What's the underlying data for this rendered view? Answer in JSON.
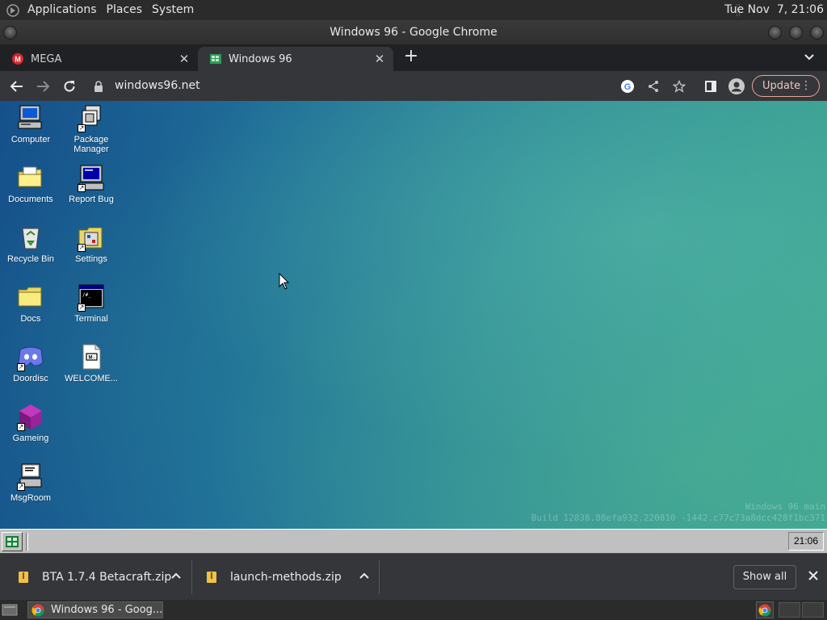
{
  "top_panel": {
    "menus": [
      "Applications",
      "Places",
      "System"
    ],
    "clock": "Tue Nov  7, 21:06"
  },
  "window": {
    "title": "Windows 96 - Google Chrome"
  },
  "tabs": [
    {
      "label": "MEGA",
      "active": false,
      "favicon": "mega-icon",
      "color": "#d9272e"
    },
    {
      "label": "Windows 96",
      "active": true,
      "favicon": "windows96-icon",
      "color": "#2e9c5a"
    }
  ],
  "toolbar": {
    "url": "windows96.net",
    "update_label": "Update"
  },
  "desktop": {
    "icons": [
      {
        "label": "Computer",
        "icon": "computer-icon"
      },
      {
        "label": "Package Manager",
        "icon": "package-manager-icon"
      },
      {
        "label": "Documents",
        "icon": "documents-folder-icon"
      },
      {
        "label": "Report Bug",
        "icon": "report-bug-icon"
      },
      {
        "label": "Recycle Bin",
        "icon": "recycle-bin-icon"
      },
      {
        "label": "Settings",
        "icon": "settings-icon"
      },
      {
        "label": "Docs",
        "icon": "docs-folder-icon"
      },
      {
        "label": "Terminal",
        "icon": "terminal-icon"
      },
      {
        "label": "Doordisc",
        "icon": "doordisc-icon"
      },
      {
        "label": "WELCOME...",
        "icon": "markdown-file-icon"
      },
      {
        "label": "Gameing",
        "icon": "gameing-icon"
      },
      {
        "label": "MsgRoom",
        "icon": "msgroom-icon"
      }
    ],
    "watermark_line1": "Windows 96 main",
    "watermark_line2": "Build 12838.88efa932.220810 -1442.c77c73a8dcc428f1bc371"
  },
  "w96_taskbar": {
    "clock": "21:06"
  },
  "downloads": {
    "items": [
      {
        "filename": "BTA 1.7.4 Betacraft.zip"
      },
      {
        "filename": "launch-methods.zip"
      }
    ],
    "show_all_label": "Show all"
  },
  "bottom_panel": {
    "task_label": "Windows 96 - Goog..."
  },
  "colors": {
    "accent_update": "#e5a79a",
    "chrome_dark": "#202124",
    "chrome_toolbar": "#35363a",
    "w96_gray": "#c0c0c0"
  }
}
